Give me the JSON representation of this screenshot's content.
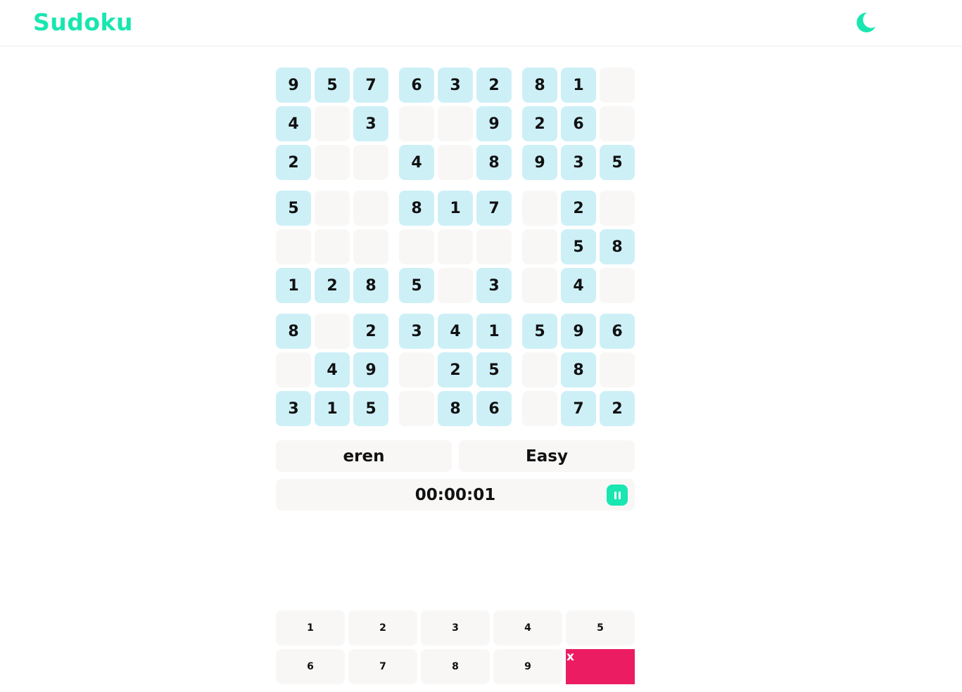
{
  "app": {
    "title": "Sudoku",
    "accent_color": "#19e6b0",
    "given_cell_color": "#cdf0f7",
    "empty_cell_color": "#f8f7f6",
    "erase_color": "#ec1c63",
    "theme_icon": "moon-icon"
  },
  "board": {
    "grid": [
      [
        9,
        5,
        7,
        6,
        3,
        2,
        8,
        1,
        0
      ],
      [
        4,
        0,
        3,
        0,
        0,
        9,
        2,
        6,
        0
      ],
      [
        2,
        0,
        0,
        4,
        0,
        8,
        9,
        3,
        5
      ],
      [
        5,
        0,
        0,
        8,
        1,
        7,
        0,
        2,
        0
      ],
      [
        0,
        0,
        0,
        0,
        0,
        0,
        0,
        5,
        8
      ],
      [
        1,
        2,
        8,
        5,
        0,
        3,
        0,
        4,
        0
      ],
      [
        8,
        0,
        2,
        3,
        4,
        1,
        5,
        9,
        6
      ],
      [
        0,
        4,
        9,
        0,
        2,
        5,
        0,
        8,
        0
      ],
      [
        3,
        1,
        5,
        0,
        8,
        6,
        0,
        7,
        2
      ]
    ]
  },
  "info": {
    "player_name": "eren",
    "difficulty": "Easy",
    "timer": "00:00:01",
    "pause_icon": "pause-icon"
  },
  "numpad": {
    "keys": [
      "1",
      "2",
      "3",
      "4",
      "5",
      "6",
      "7",
      "8",
      "9"
    ],
    "erase_label": "x"
  }
}
